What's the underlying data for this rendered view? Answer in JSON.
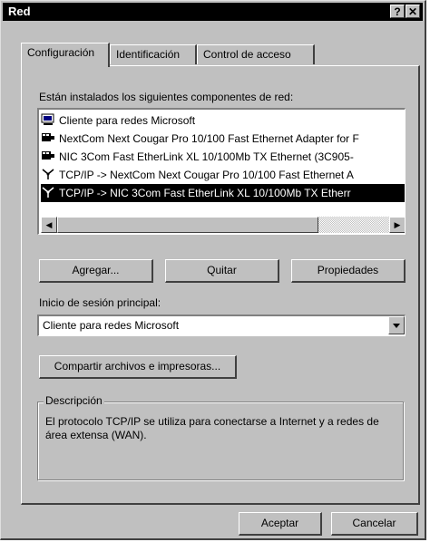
{
  "window": {
    "title": "Red",
    "help_btn": "?",
    "close_btn": "✕"
  },
  "tabs": [
    {
      "label": "Configuración"
    },
    {
      "label": "Identificación"
    },
    {
      "label": "Control de acceso"
    }
  ],
  "components": {
    "label": "Están instalados los siguientes componentes de red:",
    "items": [
      {
        "icon": "client-icon",
        "text": "Cliente para redes Microsoft"
      },
      {
        "icon": "network-adapter-icon",
        "text": "NextCom Next Cougar Pro 10/100 Fast Ethernet Adapter for F"
      },
      {
        "icon": "network-adapter-icon",
        "text": "NIC 3Com Fast EtherLink XL 10/100Mb TX Ethernet (3C905-"
      },
      {
        "icon": "protocol-icon",
        "text": "TCP/IP -> NextCom Next Cougar Pro 10/100 Fast Ethernet A"
      },
      {
        "icon": "protocol-icon",
        "text": "TCP/IP -> NIC 3Com Fast EtherLink XL 10/100Mb TX Etherr"
      }
    ]
  },
  "buttons": {
    "add": "Agregar...",
    "remove": "Quitar",
    "properties": "Propiedades"
  },
  "logon": {
    "label": "Inicio de sesión principal:",
    "value": "Cliente para redes Microsoft"
  },
  "share_button": "Compartir archivos e impresoras...",
  "description": {
    "legend": "Descripción",
    "text": "El protocolo TCP/IP se utiliza para conectarse a Internet y a redes de área extensa (WAN)."
  },
  "footer": {
    "ok": "Aceptar",
    "cancel": "Cancelar"
  }
}
